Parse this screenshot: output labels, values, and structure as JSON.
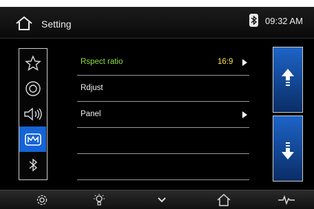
{
  "header": {
    "title": "Setting",
    "time": "09:32 AM",
    "home_icon": "home-icon",
    "status_icon": "bluetooth-icon"
  },
  "sidebar": {
    "items": [
      {
        "icon": "star-icon",
        "active": false
      },
      {
        "icon": "disc-icon",
        "active": false
      },
      {
        "icon": "speaker-icon",
        "active": false
      },
      {
        "icon": "display-settings-icon",
        "active": true
      },
      {
        "icon": "bluetooth-icon",
        "active": false
      }
    ]
  },
  "list": {
    "rows": [
      {
        "label": "Rspect ratio",
        "value": "16:9",
        "has_arrow": true,
        "highlight": true
      },
      {
        "label": "Rdjust",
        "value": "",
        "has_arrow": false,
        "highlight": false
      },
      {
        "label": "Panel",
        "value": "",
        "has_arrow": true,
        "highlight": false
      },
      {
        "label": "",
        "value": "",
        "has_arrow": false,
        "highlight": false
      },
      {
        "label": "",
        "value": "",
        "has_arrow": false,
        "highlight": false
      }
    ]
  },
  "scroll": {
    "up_icon": "arrow-up-icon",
    "down_icon": "arrow-down-icon"
  },
  "bottom_bar": {
    "items": [
      "gear-icon",
      "brightness-icon",
      "chevron-down-icon",
      "home-icon",
      "pulse-icon"
    ]
  },
  "colors": {
    "accent": "#1564d6",
    "highlight_label": "#8ee03a",
    "value": "#f5e03a"
  }
}
